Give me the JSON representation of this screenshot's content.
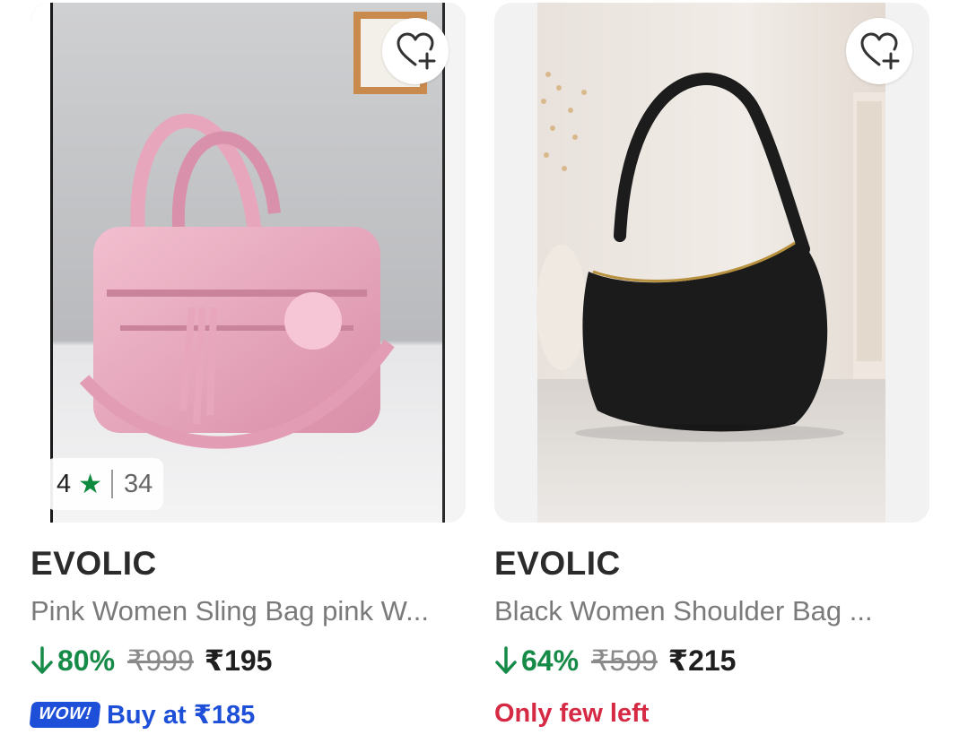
{
  "products": [
    {
      "brand": "EVOLIC",
      "title": "Pink Women Sling Bag pink W...",
      "rating": "4",
      "rating_count": "34",
      "discount": "80%",
      "mrp": "₹999",
      "price": "₹195",
      "offer_badge": "WOW!",
      "offer_text": "Buy at ₹185"
    },
    {
      "brand": "EVOLIC",
      "title": "Black Women Shoulder Bag ...",
      "discount": "64%",
      "mrp": "₹599",
      "price": "₹215",
      "stock_text": "Only few left"
    }
  ],
  "colors": {
    "discount_green": "#168a47",
    "wow_blue": "#1d4fd8",
    "stock_red": "#d52944",
    "star_green": "#0e8a3f"
  },
  "icons": [
    "wishlist-add-icon",
    "star-icon",
    "down-arrow-icon"
  ]
}
